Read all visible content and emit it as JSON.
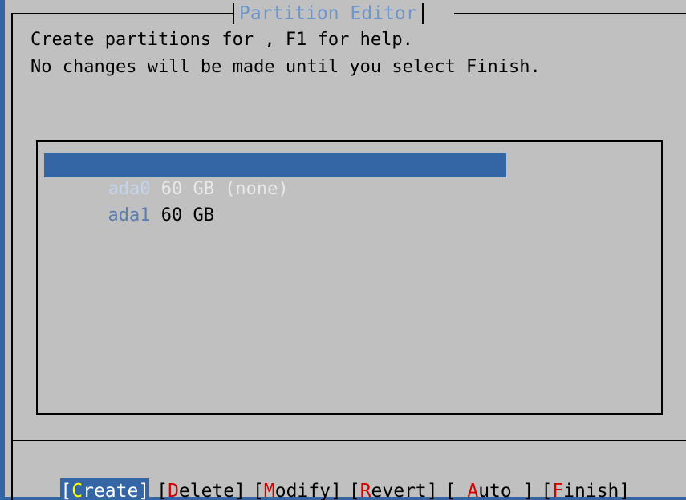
{
  "dialog": {
    "title": "Partition Editor",
    "prompt_line1": "Create partitions for , F1 for help.",
    "prompt_line2": "No changes will be made until you select Finish."
  },
  "disks": [
    {
      "name": "ada0",
      "info": "60 GB (none)",
      "selected": true
    },
    {
      "name": "ada1",
      "info": "60 GB",
      "selected": false
    }
  ],
  "buttons": [
    {
      "pre": "[",
      "hotkey": "C",
      "rest": "reate]",
      "active": true
    },
    {
      "pre": "[",
      "hotkey": "D",
      "rest": "elete]",
      "active": false
    },
    {
      "pre": "[",
      "hotkey": "M",
      "rest": "odify]",
      "active": false
    },
    {
      "pre": "[",
      "hotkey": "R",
      "rest": "evert]",
      "active": false
    },
    {
      "pre": "[ ",
      "hotkey": "A",
      "rest": "uto ]",
      "active": false
    },
    {
      "pre": "[",
      "hotkey": "F",
      "rest": "inish]",
      "active": false
    }
  ],
  "colors": {
    "background": "#c0c0c0",
    "accent": "#3465a4",
    "title_text": "#6f96c9",
    "hotkey": "#d40000",
    "active_hotkey": "#ffff00"
  }
}
